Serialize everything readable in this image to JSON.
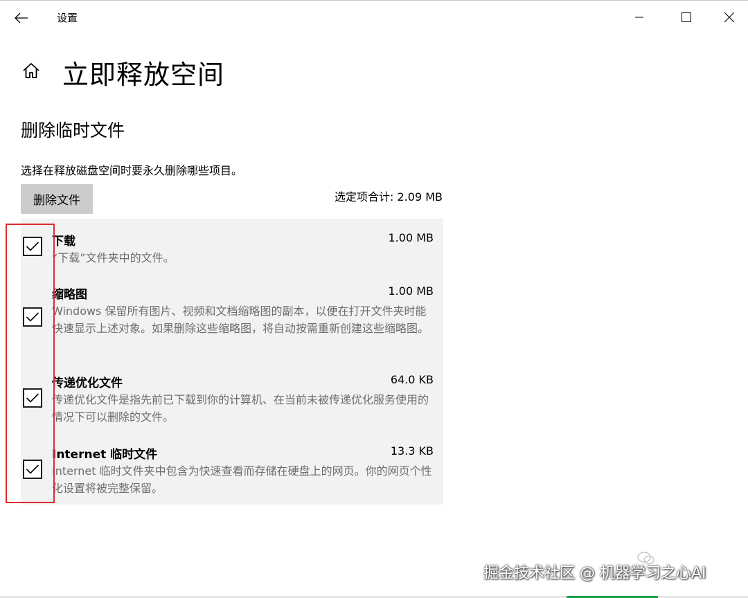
{
  "window": {
    "app_title": "设置",
    "back_icon": "back-arrow-icon",
    "minimize_icon": "minimize-icon",
    "maximize_icon": "maximize-icon",
    "close_icon": "close-icon"
  },
  "header": {
    "home_icon": "home-icon",
    "page_title": "立即释放空间"
  },
  "section": {
    "title": "删除临时文件",
    "instruction": "选择在释放磁盘空间时要永久删除哪些项目。",
    "delete_button": "删除文件",
    "total_label": "选定项合计: 2.09 MB"
  },
  "items": [
    {
      "name": "下载",
      "size": "1.00 MB",
      "description": "“下载”文件夹中的文件。",
      "checked": true
    },
    {
      "name": "缩略图",
      "size": "1.00 MB",
      "description": "Windows 保留所有图片、视频和文档缩略图的副本，以便在打开文件夹时能快速显示上述对象。如果删除这些缩略图，将自动按需重新创建这些缩略图。",
      "checked": true
    },
    {
      "name": "传递优化文件",
      "size": "64.0 KB",
      "description": "传递优化文件是指先前已下载到你的计算机、在当前未被传递优化服务使用的情况下可以删除的文件。",
      "checked": true
    },
    {
      "name": "Internet 临时文件",
      "size": "13.3 KB",
      "description": "Internet 临时文件夹中包含为快速查看而存储在硬盘上的网页。你的网页个性化设置将被完整保留。",
      "checked": true
    }
  ],
  "watermark": {
    "text": "掘金技术社区 @ 机器学习之心AI"
  },
  "colors": {
    "accent_highlight": "#e02b2b",
    "list_background": "#f2f2f2",
    "button_background": "#cccccc",
    "description_text": "#6d6d6d"
  }
}
